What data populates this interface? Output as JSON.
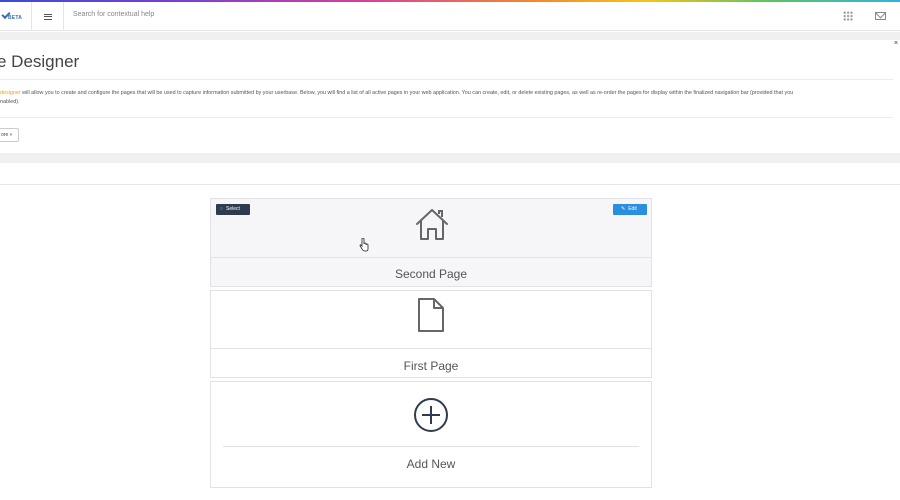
{
  "topbar": {
    "logo_badge": "BETA",
    "search_placeholder": "Search for contextual help",
    "icons": [
      "logo-check-icon",
      "hamburger-menu-icon",
      "apps-grid-icon",
      "mail-icon"
    ]
  },
  "header": {
    "title": "e Designer",
    "description_highlight": "designer",
    "description_line1": " will allow you to create and configure the pages that will be used to capture information submitted by your userbase. Below, you will find a list of all active pages in your web application. You can create, edit, or delete existing pages, as well as re-order the pages for display within the finalized navigation bar (provided that you",
    "description_line2": "nabled).",
    "more_label": "ore »",
    "close_label": "×"
  },
  "cards": [
    {
      "label": "Second Page",
      "icon": "home-icon",
      "select_label": "Select",
      "edit_label": "Edit"
    },
    {
      "label": "First Page",
      "icon": "document-icon"
    },
    {
      "label": "Add New",
      "icon": "plus-circle-icon"
    }
  ],
  "colors": {
    "select_button": "#2f3c4f",
    "edit_button": "#2b8fe0",
    "highlight": "#f0a020",
    "band": "#f0f0f3"
  }
}
